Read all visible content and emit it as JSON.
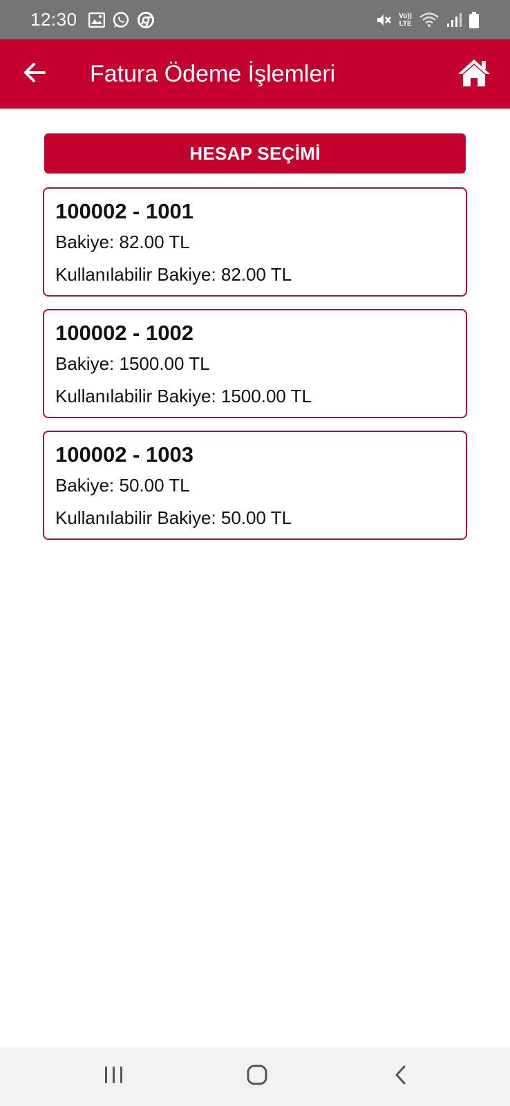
{
  "status_bar": {
    "time": "12:30",
    "lte_top": "Vo))",
    "lte_bottom": "LTE",
    "icons": [
      "gallery-icon",
      "whatsapp-icon",
      "chrome-icon",
      "mute-icon",
      "wifi-icon",
      "signal-icon",
      "battery-icon"
    ]
  },
  "app_bar": {
    "title": "Fatura Ödeme İşlemleri",
    "back_icon": "arrow-left-icon",
    "home_icon": "home-icon"
  },
  "section": {
    "title": "HESAP SEÇİMİ"
  },
  "accounts": [
    {
      "number": "100002 - 1001",
      "balance": "Bakiye: 82.00 TL",
      "available": "Kullanılabilir Bakiye: 82.00 TL"
    },
    {
      "number": "100002 - 1002",
      "balance": "Bakiye: 1500.00 TL",
      "available": "Kullanılabilir Bakiye: 1500.00 TL"
    },
    {
      "number": "100002 - 1003",
      "balance": "Bakiye: 50.00 TL",
      "available": "Kullanılabilir Bakiye: 50.00 TL"
    }
  ],
  "nav_bar": {
    "icons": [
      "recent-apps-icon",
      "home-nav-icon",
      "back-nav-icon"
    ]
  },
  "colors": {
    "brand": "#c4002f",
    "card_border": "#a8123a",
    "status_bar": "#757575"
  }
}
